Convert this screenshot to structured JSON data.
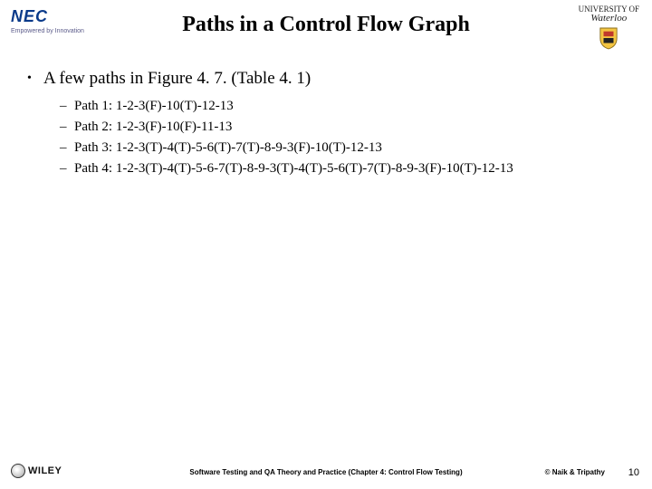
{
  "header": {
    "nec_brand": "NEC",
    "nec_tagline": "Empowered by Innovation",
    "title": "Paths in a Control Flow Graph",
    "waterloo_line1": "UNIVERSITY OF",
    "waterloo_line2": "Waterloo"
  },
  "content": {
    "bullet_main": "A few paths in Figure 4. 7. (Table 4. 1)",
    "paths": [
      "Path 1: 1-2-3(F)-10(T)-12-13",
      "Path 2: 1-2-3(F)-10(F)-11-13",
      "Path 3: 1-2-3(T)-4(T)-5-6(T)-7(T)-8-9-3(F)-10(T)-12-13",
      "Path 4: 1-2-3(T)-4(T)-5-6-7(T)-8-9-3(T)-4(T)-5-6(T)-7(T)-8-9-3(F)-10(T)-12-13"
    ]
  },
  "footer": {
    "wiley": "WILEY",
    "center": "Software Testing and QA Theory and Practice (Chapter 4: Control Flow Testing)",
    "copyright": "© Naik & Tripathy",
    "page": "10"
  }
}
